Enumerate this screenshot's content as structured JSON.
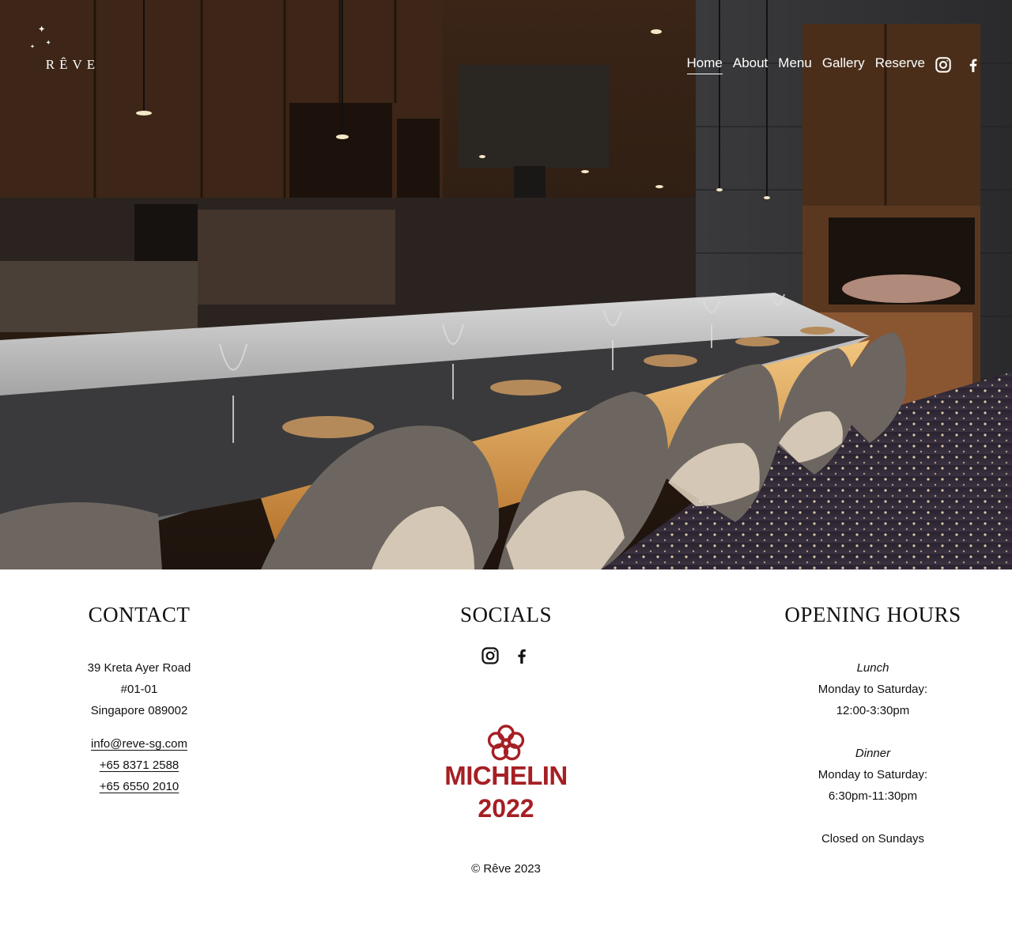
{
  "brand": {
    "logo_text": "RÊVE"
  },
  "nav": {
    "items": [
      {
        "label": "Home",
        "active": true
      },
      {
        "label": "About",
        "active": false
      },
      {
        "label": "Menu",
        "active": false
      },
      {
        "label": "Gallery",
        "active": false
      },
      {
        "label": "Reserve",
        "active": false
      }
    ]
  },
  "social_icons": [
    "instagram-icon",
    "facebook-icon"
  ],
  "contact": {
    "heading": "CONTACT",
    "address_line1": "39 Kreta Ayer Road",
    "address_line2": "#01-01",
    "address_line3": "Singapore 089002",
    "email": "info@reve-sg.com",
    "phone1": "+65 8371 2588",
    "phone2": "+65 6550 2010"
  },
  "socials": {
    "heading": "SOCIALS"
  },
  "michelin": {
    "word": "MICHELIN",
    "year": "2022",
    "color": "#a51f24"
  },
  "hours": {
    "heading": "OPENING HOURS",
    "lunch_label": "Lunch",
    "lunch_days": "Monday to Saturday:",
    "lunch_time": "12:00-3:30pm",
    "dinner_label": "Dinner",
    "dinner_days": "Monday to Saturday:",
    "dinner_time": "6:30pm-11:30pm",
    "closed": "Closed on Sundays"
  },
  "copyright": "© Rêve 2023"
}
